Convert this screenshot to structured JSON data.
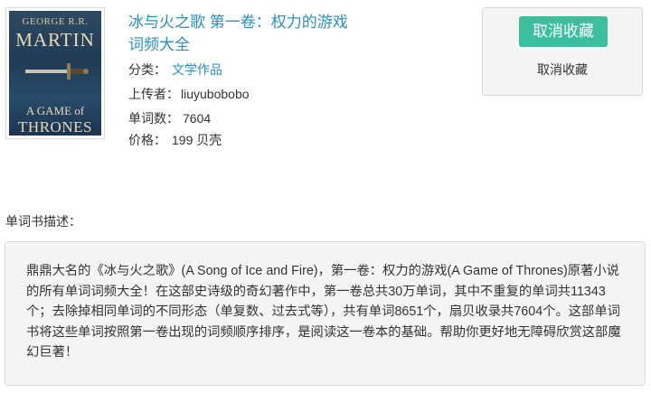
{
  "book": {
    "cover": {
      "author_line1": "GEORGE R.R.",
      "author_line2": "MARTIN",
      "title_line1": "A GAME of",
      "title_line2": "THRONES"
    },
    "title": "冰与火之歌 第一卷：权力的游戏 词频大全",
    "category_label": "分类：",
    "category_value": "文学作品",
    "uploader_label": "上传者：",
    "uploader_value": "liuyubobobo",
    "word_count_label": "单词数：",
    "word_count_value": "7604",
    "price_label": "价格：",
    "price_value": "199 贝壳"
  },
  "favorite": {
    "button_label": "取消收藏",
    "status_label": "取消收藏",
    "accent": "#3cbf9f"
  },
  "description": {
    "label": "单词书描述：",
    "text": "鼎鼎大名的《冰与火之歌》(A Song of Ice and Fire)，第一卷：权力的游戏(A Game of Thrones)原著小说的所有单词词频大全！在这部史诗级的奇幻著作中，第一卷总共30万单词，其中不重复的单词共11343个；去除掉相同单词的不同形态（单复数、过去式等），共有单词8651个，扇贝收录共7604个。这部单词书将这些单词按照第一卷出现的词频顺序排序，是阅读这一卷本的基础。帮助你更好地无障碍欣赏这部魔幻巨著！"
  },
  "colors": {
    "link": "#2a8fc6",
    "panel_bg": "#f5f5f5"
  }
}
